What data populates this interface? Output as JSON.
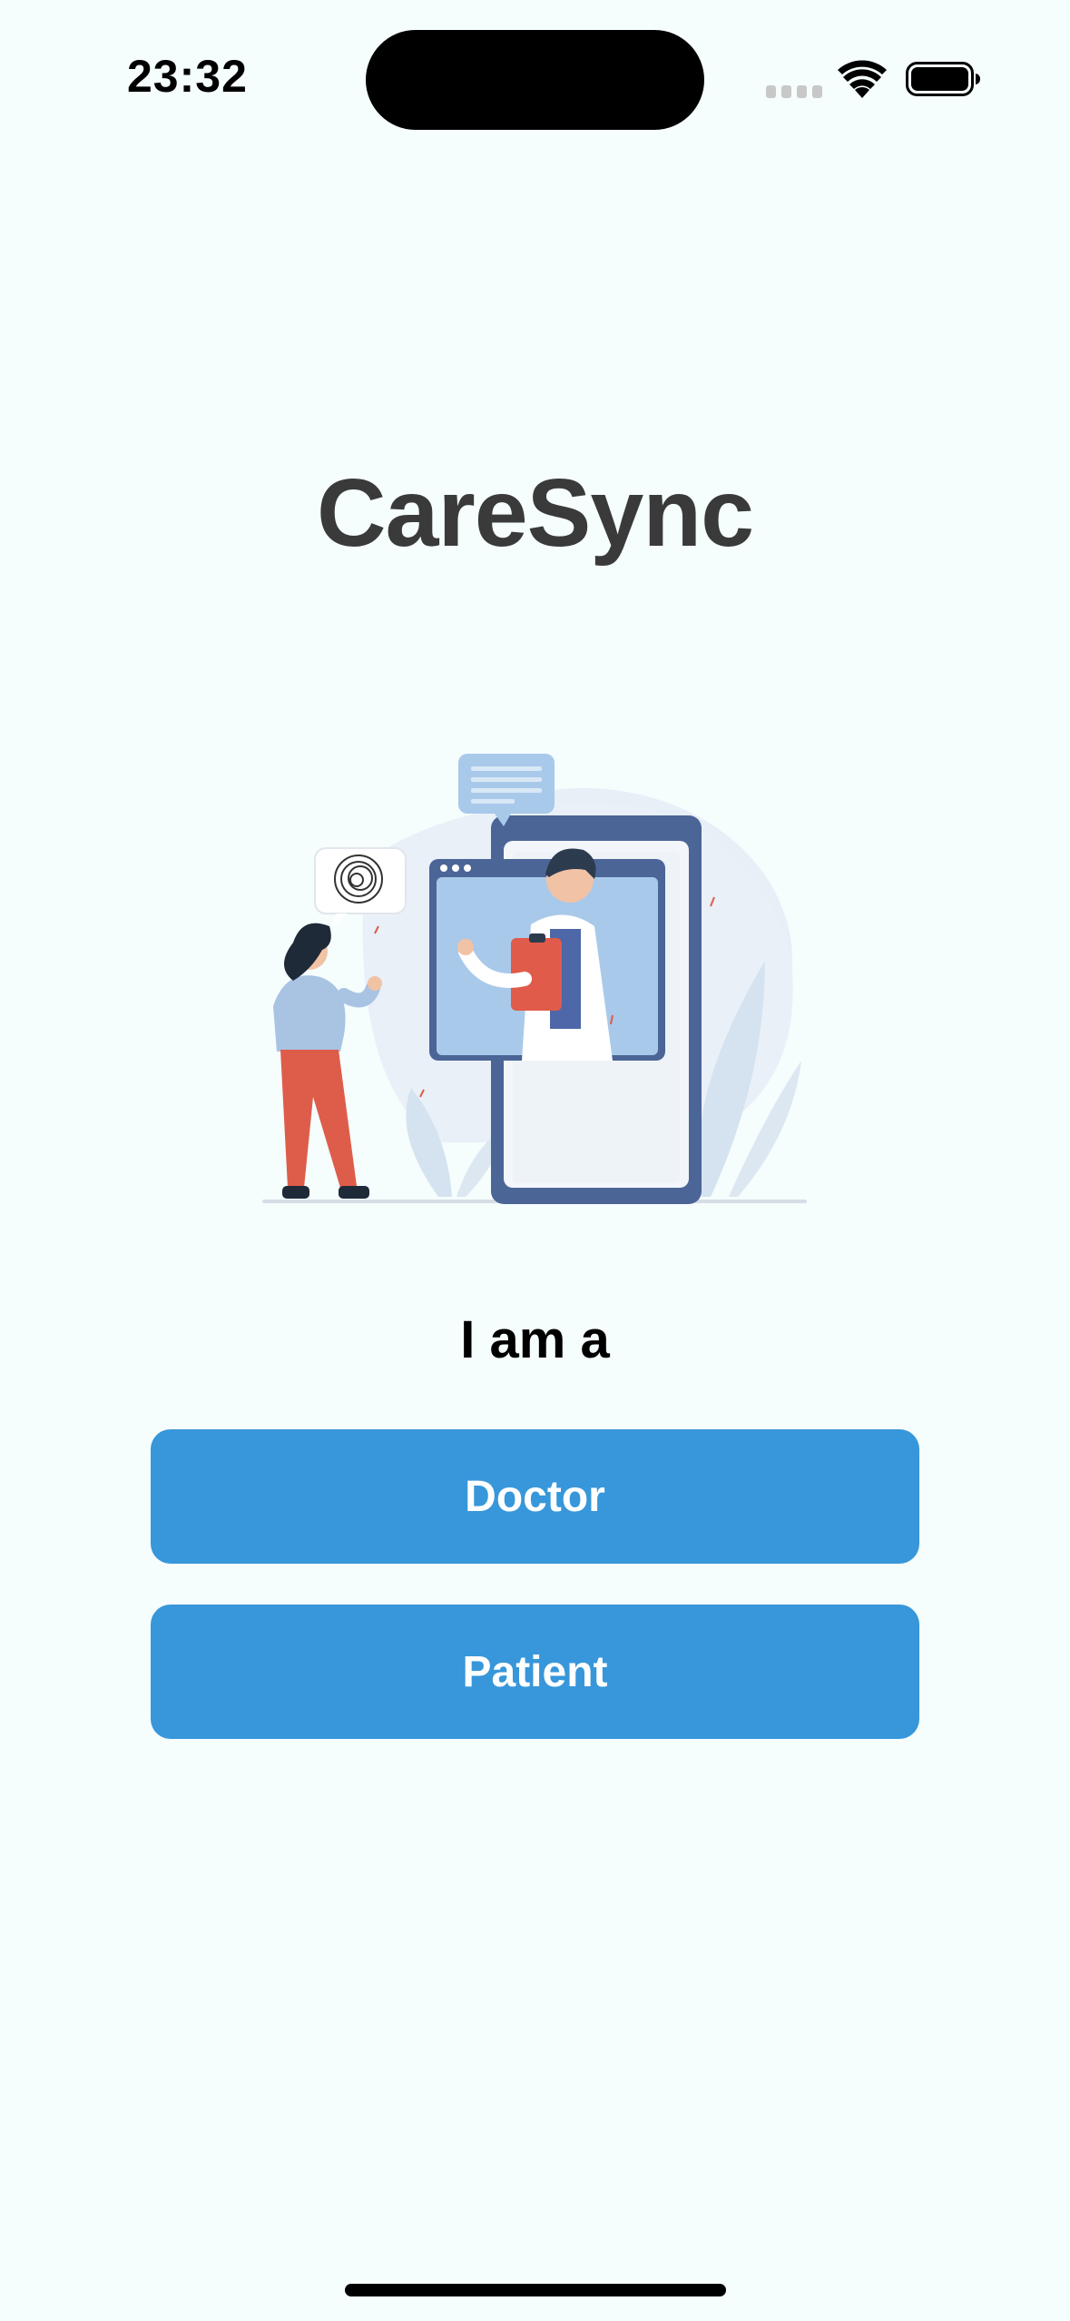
{
  "status_bar": {
    "time": "23:32",
    "signal_icon": "cellular-signal-icon",
    "wifi_icon": "wifi-icon",
    "battery_icon": "battery-full-icon"
  },
  "app": {
    "title": "CareSync"
  },
  "illustration": {
    "semantic": "telemedicine-illustration"
  },
  "role_select": {
    "heading": "I am a",
    "doctor_label": "Doctor",
    "patient_label": "Patient"
  },
  "colors": {
    "background": "#F5FDFD",
    "button": "#3797DA",
    "title": "#3A3A3A"
  }
}
